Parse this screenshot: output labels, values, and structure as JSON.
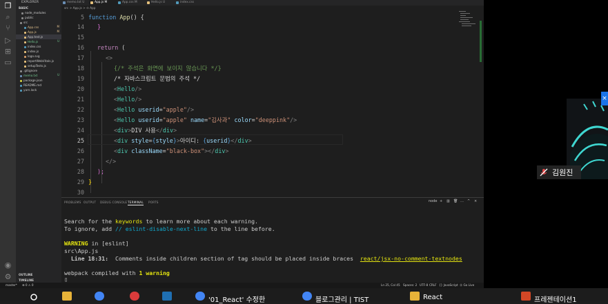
{
  "explorer": {
    "title": "EXPLORER",
    "root": "BASIC",
    "items": [
      {
        "label": "node_modules",
        "badge": ""
      },
      {
        "label": "public",
        "badge": ""
      },
      {
        "label": "src",
        "badge": ""
      },
      {
        "label": "App.css",
        "badge": "M"
      },
      {
        "label": "App.js",
        "badge": "M"
      },
      {
        "label": "App.test.js",
        "badge": ""
      },
      {
        "label": "Hello.js",
        "badge": "U"
      },
      {
        "label": "index.css",
        "badge": ""
      },
      {
        "label": "index.js",
        "badge": ""
      },
      {
        "label": "logo.svg",
        "badge": ""
      },
      {
        "label": "reportWebVitals.js",
        "badge": ""
      },
      {
        "label": "setupTests.js",
        "badge": ""
      },
      {
        "label": ".gitignore",
        "badge": ""
      },
      {
        "label": "memo.txt",
        "badge": "U"
      },
      {
        "label": "package.json",
        "badge": ""
      },
      {
        "label": "README.md",
        "badge": ""
      },
      {
        "label": "yarn.lock",
        "badge": ""
      }
    ],
    "outline": "OUTLINE",
    "timeline": "TIMELINE"
  },
  "tabs": [
    {
      "label": "memo.txt U",
      "color": "#6b8fb5"
    },
    {
      "label": "App.js M",
      "color": "#e5c07b"
    },
    {
      "label": "App.css M",
      "color": "#519aba"
    },
    {
      "label": "Hello.js U",
      "color": "#e5c07b"
    },
    {
      "label": "index.css",
      "color": "#519aba"
    }
  ],
  "breadcrumb": "src > App.js > ⊙ App",
  "editor": {
    "line_numbers": [
      "5",
      "14",
      "15",
      "16",
      "17",
      "18",
      "19",
      "20",
      "21",
      "22",
      "23",
      "24",
      "25",
      "26",
      "27",
      "28",
      "29",
      "30"
    ],
    "line5_kw": "function",
    "line5_fn": "App",
    "line5_rest": "() {",
    "line14": "}",
    "line16_kw": "return",
    "line16_rest": " (",
    "line17": "<>",
    "line18": "{/* 주석은 화면에 보이지 않습니다 */}",
    "line19": "/* 자바스크립트 문법의 주석 */",
    "line20_tag": "Hello",
    "line21_tag": "Hello",
    "line22_tag": "Hello",
    "line22_attr": "userid",
    "line22_val": "\"apple\"",
    "line23_tag": "Hello",
    "line23_attr1": "userid",
    "line23_val1": "\"apple\"",
    "line23_attr2": "name",
    "line23_val2": "\"김사과\"",
    "line23_attr3": "color",
    "line23_val3": "\"deeppink\"",
    "line24_tag": "div",
    "line24_text": "DIV 사용",
    "line25_tag": "div",
    "line25_attr": "style",
    "line25_expr": "style",
    "line25_text": "아이디: ",
    "line25_expr2": "userid",
    "line26_tag": "div",
    "line26_attr": "className",
    "line26_val": "\"black-box\"",
    "line27": "</>",
    "line28": ");",
    "line29": "}"
  },
  "panel": {
    "tabs": [
      "PROBLEMS",
      "OUTPUT",
      "DEBUG CONSOLE",
      "TERMINAL",
      "PORTS"
    ],
    "active_tab": "TERMINAL",
    "shell": "node",
    "lines": {
      "l1_pre": "Search for the ",
      "l1_kw": "keywords",
      "l1_post": " to learn more about each warning.",
      "l2_pre": "To ignore, add ",
      "l2_kw": "// eslint-disable-next-line",
      "l2_post": " to the line before.",
      "l3_warn": "WARNING",
      "l3_rest": " in [eslint]",
      "l4": "src\\App.js",
      "l5_loc": "  Line 18:31:",
      "l5_msg": "  Comments inside children section of tag should be placed inside braces  ",
      "l5_rule": "react/jsx-no-comment-textnodes",
      "l6_pre": "webpack compiled with ",
      "l6_warn": "1 warning"
    }
  },
  "statusbar": {
    "branch": "master*",
    "problems": "⊗ 0 ⚠ 0",
    "position": "Ln 25, Col 45",
    "spaces": "Spaces: 2",
    "encoding": "UTF-8",
    "eol": "CRLF",
    "language": "{} JavaScript",
    "golive": "⦿ Go Live"
  },
  "video": {
    "speaker_name": "김원진"
  },
  "taskbar": {
    "items": [
      {
        "label": "'01_React' 수정한",
        "color": "#4285f4"
      },
      {
        "label": "블로그관리 | TIST",
        "color": "#4285f4"
      },
      {
        "label": "React",
        "color": "#e8b339"
      },
      {
        "label": "프레젠테이션1",
        "color": "#d24726"
      }
    ]
  }
}
